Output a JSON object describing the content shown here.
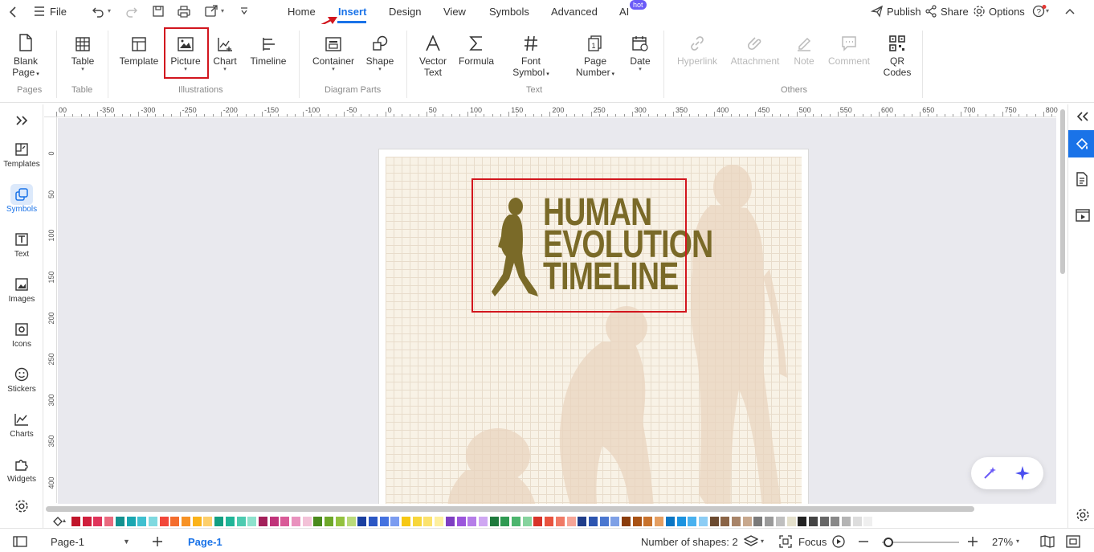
{
  "menubar": {
    "back_icon": "chevron-left-icon",
    "file_label": "File",
    "tabs": [
      {
        "label": "Home",
        "active": false
      },
      {
        "label": "Insert",
        "active": true
      },
      {
        "label": "Design",
        "active": false
      },
      {
        "label": "View",
        "active": false
      },
      {
        "label": "Symbols",
        "active": false
      },
      {
        "label": "Advanced",
        "active": false
      },
      {
        "label": "AI",
        "active": false
      }
    ],
    "ai_badge": "hot",
    "publish_label": "Publish",
    "share_label": "Share",
    "options_label": "Options"
  },
  "ribbon": {
    "groups": {
      "pages": "Pages",
      "table": "Table",
      "illustrations": "Illustrations",
      "diagram_parts": "Diagram Parts",
      "text": "Text",
      "others": "Others"
    },
    "buttons": {
      "blank_page": [
        "Blank",
        "Page"
      ],
      "table": "Table",
      "template": "Template",
      "picture": "Picture",
      "chart": "Chart",
      "timeline": "Timeline",
      "container": "Container",
      "shape": "Shape",
      "vector_text": [
        "Vector",
        "Text"
      ],
      "formula": "Formula",
      "font_symbol": [
        "Font",
        "Symbol"
      ],
      "page_number": [
        "Page",
        "Number"
      ],
      "date": "Date",
      "hyperlink": "Hyperlink",
      "attachment": "Attachment",
      "note": "Note",
      "comment": "Comment",
      "qr_codes": [
        "QR",
        "Codes"
      ]
    }
  },
  "leftbar": {
    "items": [
      {
        "label": "Templates",
        "icon": "templates-icon"
      },
      {
        "label": "Symbols",
        "icon": "symbols-icon",
        "active": true
      },
      {
        "label": "Text",
        "icon": "text-icon"
      },
      {
        "label": "Images",
        "icon": "images-icon"
      },
      {
        "label": "Icons",
        "icon": "icons-icon"
      },
      {
        "label": "Stickers",
        "icon": "stickers-icon"
      },
      {
        "label": "Charts",
        "icon": "charts-icon"
      },
      {
        "label": "Widgets",
        "icon": "widgets-icon"
      }
    ]
  },
  "rulers": {
    "horizontal": [
      "00",
      "-350",
      "-300",
      "-250",
      "-200",
      "-150",
      "-100",
      "-50",
      "0",
      "50",
      "100",
      "150",
      "200",
      "250",
      "300",
      "350",
      "400",
      "450",
      "500",
      "550",
      "600",
      "650",
      "700",
      "750",
      "800"
    ],
    "vertical": [
      "0",
      "50",
      "100",
      "150",
      "200",
      "250",
      "300",
      "350",
      "400"
    ]
  },
  "canvas": {
    "title_lines": [
      "HUMAN",
      "EVOLUTION",
      "TIMELINE"
    ],
    "title_color": "#7a6a28",
    "page_bg": "#f8f2e6"
  },
  "colorbar": {
    "swatches": [
      "#c0152a",
      "#d01f3c",
      "#e0345a",
      "#e96a7f",
      "#13918f",
      "#1aa7b1",
      "#3fc0d0",
      "#7fd9e0",
      "#f2473a",
      "#f46d2e",
      "#f79225",
      "#fbb31a",
      "#fdcf6b",
      "#139f82",
      "#21b598",
      "#4dcbb0",
      "#8ee2cd",
      "#a3205a",
      "#c0337a",
      "#d95b98",
      "#e992be",
      "#f3c2d8",
      "#4a8a1d",
      "#6ea82a",
      "#93c23f",
      "#bada7a",
      "#1a3fa0",
      "#2b57c4",
      "#4472e0",
      "#7b9cf0",
      "#f6c814",
      "#f7d63c",
      "#fbe26d",
      "#fdef9f",
      "#7e3ec2",
      "#9b55dc",
      "#b57de8",
      "#cfa7f2",
      "#1f7a3d",
      "#2f9a52",
      "#4cb56e",
      "#86d39e",
      "#d8332a",
      "#e8533f",
      "#f07a66",
      "#f6a597",
      "#1f3d8a",
      "#2c55b0",
      "#4a77d0",
      "#7ea0e6",
      "#8a3c0b",
      "#a95214",
      "#c8722c",
      "#e49e61",
      "#0a76c4",
      "#1b93e0",
      "#49b1ef",
      "#8ccdf5",
      "#6b4a2f",
      "#8a6446",
      "#a88468",
      "#c8a88d",
      "#7a7a7a",
      "#9a9a9a",
      "#bfbfbf",
      "#e4e0cc",
      "#222222",
      "#444444",
      "#666666",
      "#888888",
      "#b4b4b4",
      "#dddddd",
      "#efefef"
    ]
  },
  "statusbar": {
    "page_select": "Page-1",
    "page_tab": "Page-1",
    "shapes_count": "Number of shapes: 2",
    "focus_label": "Focus",
    "zoom": "27%"
  }
}
